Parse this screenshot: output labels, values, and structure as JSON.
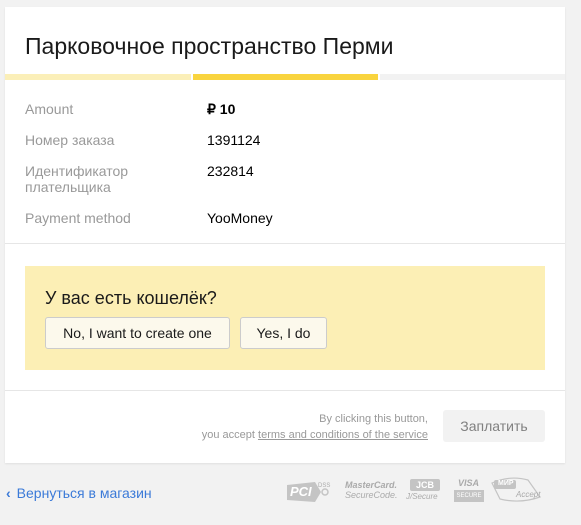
{
  "title": "Парковочное пространство Перми",
  "steps": [
    {
      "state": "done"
    },
    {
      "state": "active"
    },
    {
      "state": "pending"
    }
  ],
  "details": [
    {
      "label": "Amount",
      "value": "₽ 10"
    },
    {
      "label": "Номер заказа",
      "value": "1391124"
    },
    {
      "label": "Идентификатор плательщика",
      "value": "232814"
    },
    {
      "label": "Payment method",
      "value": "YooMoney"
    }
  ],
  "wallet": {
    "question": "У вас есть кошелёк?",
    "no_label": "No, I want to create one",
    "yes_label": "Yes, I do"
  },
  "consent": {
    "line1": "By clicking this button,",
    "line2_prefix": "you accept ",
    "terms_link": "terms and conditions of the service"
  },
  "pay_label": "Заплатить",
  "back_label": "Вернуться в магазин",
  "logos": {
    "pci": "PCI",
    "pci_dss": "DSS",
    "mc1": "MasterCard.",
    "mc2": "SecureCode.",
    "jcb": "JCB",
    "jsecure": "J/Secure",
    "visa": "VISA",
    "visa_secure": "SECURE",
    "mir": "МИР",
    "mir_accept": "Accept"
  },
  "colors": {
    "accent": "#f9d43e",
    "step_done": "#fbefb8",
    "wallet_bg": "#fcefb5",
    "link": "#3b7ad8"
  }
}
